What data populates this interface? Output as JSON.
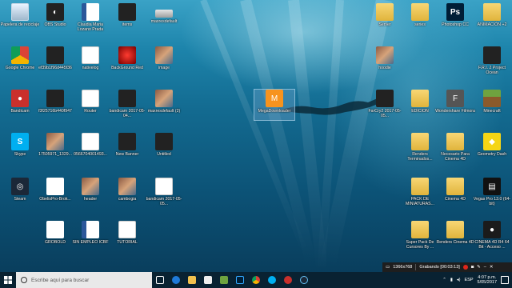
{
  "desktop": {
    "icons": [
      {
        "label": "Papelera de reciclaje",
        "icon": "recycle-bin-icon"
      },
      {
        "label": "OBS Studio",
        "icon": "obs-icon"
      },
      {
        "label": "Claudia Maria Lozano Prada",
        "icon": "word-document-icon"
      },
      {
        "label": "items",
        "icon": "dark-file-icon"
      },
      {
        "label": "maxresdefault",
        "icon": "image-file-icon"
      },
      {
        "label": "Google Chrome",
        "icon": "chrome-icon"
      },
      {
        "label": "ef39b1f96d445f36",
        "icon": "dark-file-icon"
      },
      {
        "label": "nativelog",
        "icon": "text-document-icon"
      },
      {
        "label": "BackGround Red",
        "icon": "red-image-icon"
      },
      {
        "label": "image",
        "icon": "image-file-icon"
      },
      {
        "label": "Bandicam",
        "icon": "bandicam-icon"
      },
      {
        "label": "f3f25716b440f947",
        "icon": "dark-file-icon"
      },
      {
        "label": "Router",
        "icon": "text-document-icon"
      },
      {
        "label": "bandicam 2017-05-04...",
        "icon": "video-file-icon"
      },
      {
        "label": "maxresdefault (2)",
        "icon": "image-file-icon"
      },
      {
        "label": "Skype",
        "icon": "skype-icon"
      },
      {
        "label": "17505971_1329...",
        "icon": "image-file-icon"
      },
      {
        "label": "0566704001493...",
        "icon": "pdf-icon"
      },
      {
        "label": "New Banner",
        "icon": "banner-image-icon"
      },
      {
        "label": "Untitled",
        "icon": "banner-image-icon"
      },
      {
        "label": "Steam",
        "icon": "steam-icon"
      },
      {
        "label": "ObelisPro-Brok...",
        "icon": "abg-file-icon"
      },
      {
        "label": "header",
        "icon": "image-file-icon"
      },
      {
        "label": "cambogia",
        "icon": "image-file-icon"
      },
      {
        "label": "bandicam 2017-05-05...",
        "icon": "text-document-icon"
      },
      {
        "label": "GROBOLD",
        "icon": "abg-file-icon"
      },
      {
        "label": "SIN EMPLEO ICBF",
        "icon": "word-document-icon"
      },
      {
        "label": "TUTORIAL",
        "icon": "text-document-icon"
      },
      {
        "label": "MegaDownloader",
        "icon": "megadownloader-icon"
      },
      {
        "label": "Server",
        "icon": "folder-icon"
      },
      {
        "label": "series",
        "icon": "folder-icon"
      },
      {
        "label": "Photoshop CC",
        "icon": "photoshop-icon"
      },
      {
        "label": "ANIMACIÓN +2",
        "icon": "folder-icon"
      },
      {
        "label": "hoodie",
        "icon": "image-file-icon"
      },
      {
        "label": "F.R.I. 2 Project Ocean",
        "icon": "game-icon"
      },
      {
        "label": "FarCry2 2017-05-05...",
        "icon": "video-file-icon"
      },
      {
        "label": "EDICION",
        "icon": "folder-icon"
      },
      {
        "label": "Wondershare Filmora",
        "icon": "filmora-icon"
      },
      {
        "label": "Minecraft",
        "icon": "minecraft-icon"
      },
      {
        "label": "Renders Terminados...",
        "icon": "folder-icon"
      },
      {
        "label": "Necesario Para Cinema 4D",
        "icon": "folder-icon"
      },
      {
        "label": "Geometry Dash",
        "icon": "geometry-dash-icon"
      },
      {
        "label": "PACK DE MINIATURAS...",
        "icon": "folder-icon"
      },
      {
        "label": "Cinema 4D",
        "icon": "folder-icon"
      },
      {
        "label": "Vegas Pro 13.0 (64-bit)",
        "icon": "vegas-icon"
      },
      {
        "label": "Super Pack De Cursores By ...",
        "icon": "folder-icon"
      },
      {
        "label": "Renders Cinema 4D",
        "icon": "folder-icon"
      },
      {
        "label": "CINEMA 4D R4 64 Bit - Acceso ...",
        "icon": "cinema4d-icon"
      }
    ],
    "selected_icon": "MegaDownloader"
  },
  "recorder_bar": {
    "resolution": "1366x768",
    "status": "Grabando [00:03:13]",
    "colors": {
      "record": "#e0261b"
    }
  },
  "taskbar": {
    "search_placeholder": "Escribe aquí para buscar",
    "apps": [
      "task-view-icon",
      "edge-icon",
      "explorer-icon",
      "store-icon",
      "minecraft-icon",
      "photoshop-icon",
      "chrome-icon",
      "skype-icon",
      "bandicam-icon",
      "steam-icon"
    ],
    "language": "ESP",
    "time": "4:07 p.m.",
    "date": "5/05/2017"
  },
  "colors": {
    "taskbar": "#0a1e2d",
    "search": "#e9e9e9",
    "selection": "#78aad2"
  }
}
